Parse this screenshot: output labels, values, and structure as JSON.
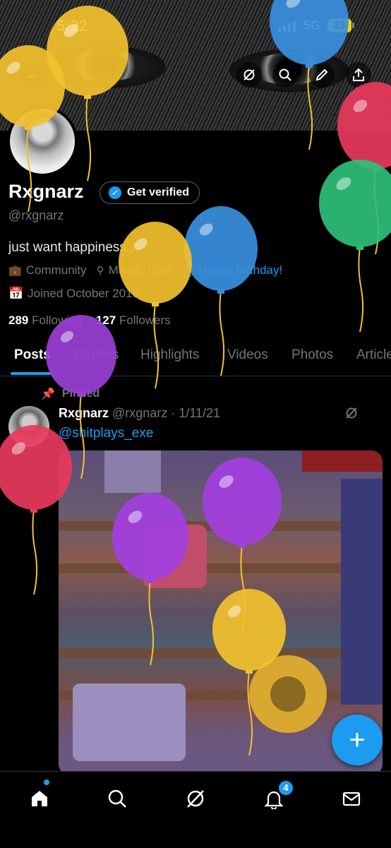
{
  "status": {
    "time": "5:22",
    "network": "5G",
    "battery": "23"
  },
  "profile": {
    "name": "Rxgnarz",
    "verify_label": "Get verified",
    "handle": "@rxgnarz",
    "bio": "just want happiness..",
    "category": "Community",
    "location": "Maine, USA",
    "birthday_text": "Happy birthday!",
    "joined": "Joined October 2019",
    "following_count": "289",
    "following_label": "Following",
    "followers_count": "127",
    "followers_label": "Followers"
  },
  "tabs": [
    "Posts",
    "Replies",
    "Highlights",
    "Videos",
    "Photos",
    "Articles"
  ],
  "post": {
    "pinned_label": "Pinned",
    "author": "Rxgnarz",
    "handle_date": "@rxgnarz · 1/11/21",
    "mention": "@shitplays_exe"
  },
  "nav": {
    "notifications_badge": "4"
  },
  "colors": {
    "accent": "#1d9bf0",
    "background": "#000000",
    "muted": "#71767b"
  }
}
